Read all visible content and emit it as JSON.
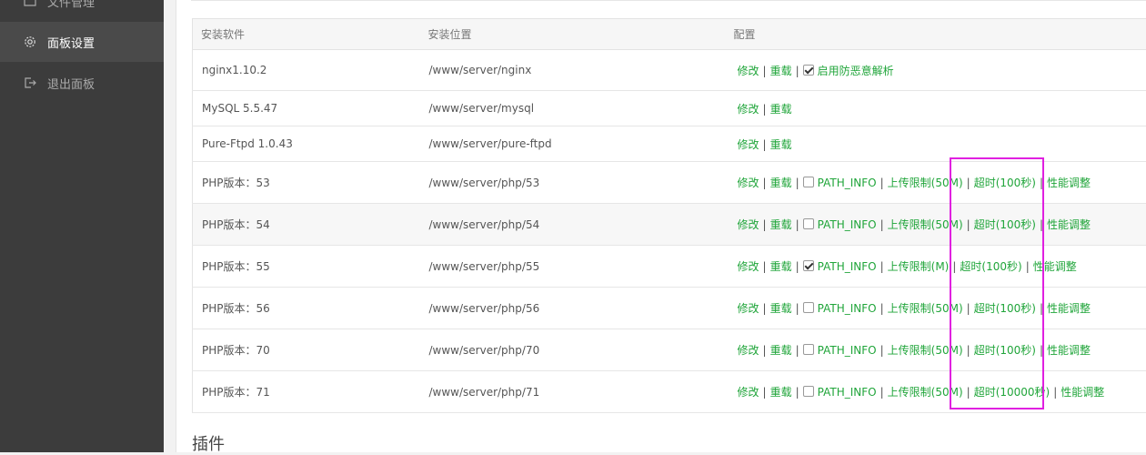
{
  "sidebar": {
    "items": [
      {
        "label": "文件管理",
        "icon": "folder-icon",
        "active": false
      },
      {
        "label": "面板设置",
        "icon": "gear-icon",
        "active": true
      },
      {
        "label": "退出面板",
        "icon": "logout-icon",
        "active": false
      }
    ]
  },
  "table": {
    "headers": [
      "安装软件",
      "安装位置",
      "配置"
    ],
    "rows": [
      {
        "name": "nginx1.10.2",
        "path": "/www/server/nginx",
        "modify": "修改",
        "reload": "重载",
        "extra_checked": true,
        "extra_label": "启用防恶意解析"
      },
      {
        "name": "MySQL 5.5.47",
        "path": "/www/server/mysql",
        "modify": "修改",
        "reload": "重载"
      },
      {
        "name": "Pure-Ftpd 1.0.43",
        "path": "/www/server/pure-ftpd",
        "modify": "修改",
        "reload": "重载"
      },
      {
        "name": "PHP版本：53",
        "path": "/www/server/php/53",
        "modify": "修改",
        "reload": "重载",
        "pathinfo": "PATH_INFO",
        "pathinfo_checked": false,
        "upload": "上传限制(50M)",
        "timeout": "超时(100秒)",
        "perf": "性能调整"
      },
      {
        "name": "PHP版本：54",
        "path": "/www/server/php/54",
        "modify": "修改",
        "reload": "重载",
        "pathinfo": "PATH_INFO",
        "pathinfo_checked": false,
        "upload": "上传限制(50M)",
        "timeout": "超时(100秒)",
        "perf": "性能调整"
      },
      {
        "name": "PHP版本：55",
        "path": "/www/server/php/55",
        "modify": "修改",
        "reload": "重载",
        "pathinfo": "PATH_INFO",
        "pathinfo_checked": true,
        "upload": "上传限制(M)",
        "timeout": "超时(100秒)",
        "perf": "性能调整"
      },
      {
        "name": "PHP版本：56",
        "path": "/www/server/php/56",
        "modify": "修改",
        "reload": "重载",
        "pathinfo": "PATH_INFO",
        "pathinfo_checked": false,
        "upload": "上传限制(50M)",
        "timeout": "超时(100秒)",
        "perf": "性能调整"
      },
      {
        "name": "PHP版本：70",
        "path": "/www/server/php/70",
        "modify": "修改",
        "reload": "重载",
        "pathinfo": "PATH_INFO",
        "pathinfo_checked": false,
        "upload": "上传限制(50M)",
        "timeout": "超时(100秒)",
        "perf": "性能调整"
      },
      {
        "name": "PHP版本：71",
        "path": "/www/server/php/71",
        "modify": "修改",
        "reload": "重载",
        "pathinfo": "PATH_INFO",
        "pathinfo_checked": false,
        "upload": "上传限制(50M)",
        "timeout": "超时(10000秒)",
        "perf": "性能调整"
      }
    ]
  },
  "section": {
    "title": "插件"
  },
  "colors": {
    "link": "#20a53a",
    "sidebar": "#3c3c3c",
    "highlight": "#e020e0"
  }
}
